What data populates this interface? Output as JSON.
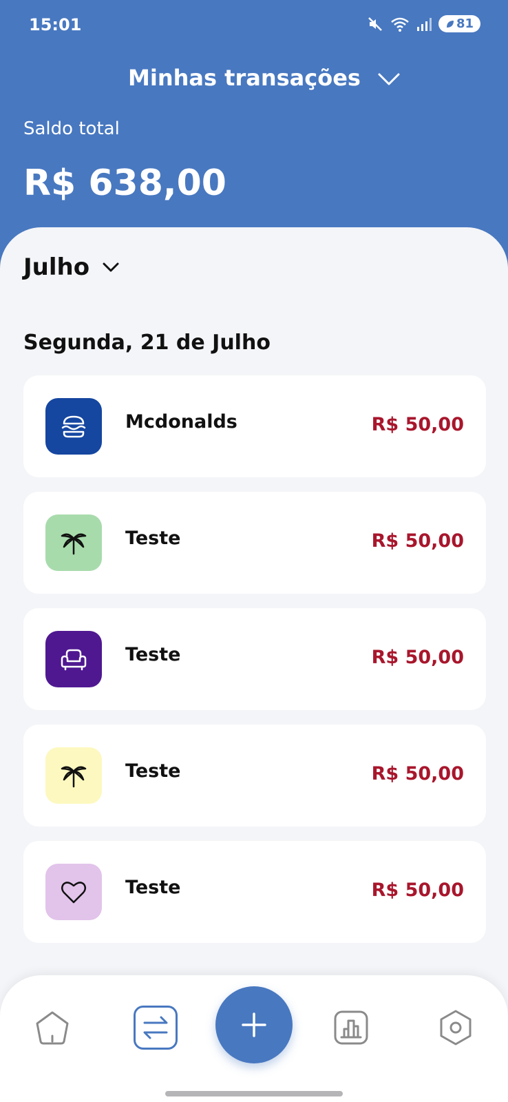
{
  "status_bar": {
    "time": "15:01",
    "battery": "81"
  },
  "header": {
    "title": "Minhas transações",
    "balance_label": "Saldo total",
    "balance_value": "R$ 638,00"
  },
  "month_selector": {
    "label": "Julho"
  },
  "day_group": {
    "heading": "Segunda, 21 de Julho"
  },
  "transactions": [
    {
      "name": "Mcdonalds",
      "amount": "R$ 50,00",
      "icon": "burger-icon",
      "icon_bg": "#1546a0"
    },
    {
      "name": "Teste",
      "amount": "R$ 50,00",
      "icon": "palm-tree-icon",
      "icon_bg": "#a8dbac"
    },
    {
      "name": "Teste",
      "amount": "R$ 50,00",
      "icon": "armchair-icon",
      "icon_bg": "#4f1891"
    },
    {
      "name": "Teste",
      "amount": "R$ 50,00",
      "icon": "palm-tree-icon",
      "icon_bg": "#fdf8c0"
    },
    {
      "name": "Teste",
      "amount": "R$ 50,00",
      "icon": "heart-icon",
      "icon_bg": "#e2c3ea"
    }
  ],
  "bottom_nav": {
    "items": [
      {
        "name": "home",
        "icon": "home-icon"
      },
      {
        "name": "transactions",
        "icon": "transfer-icon",
        "active": true
      },
      {
        "name": "add",
        "icon": "plus-icon"
      },
      {
        "name": "stats",
        "icon": "chart-icon"
      },
      {
        "name": "settings",
        "icon": "hexagon-gear-icon"
      }
    ]
  },
  "colors": {
    "primary": "#4878c0",
    "expense": "#a8162c",
    "background": "#f4f5f8"
  }
}
